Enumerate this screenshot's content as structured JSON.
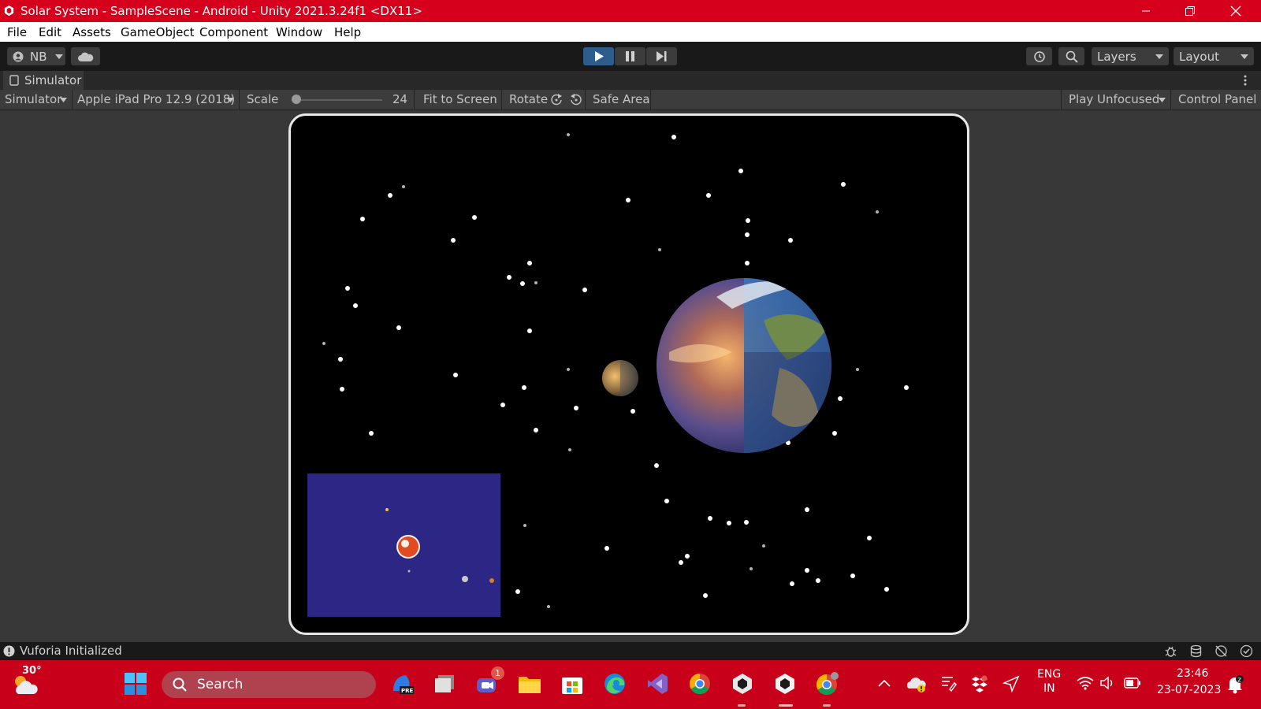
{
  "window": {
    "title": "Solar System - SampleScene - Android - Unity 2021.3.24f1 <DX11>"
  },
  "menu": [
    "File",
    "Edit",
    "Assets",
    "GameObject",
    "Component",
    "Window",
    "Help"
  ],
  "toolbar": {
    "account": "NB",
    "layers": "Layers",
    "layout": "Layout"
  },
  "simulator": {
    "tab": "Simulator",
    "mode": "Simulator",
    "device": "Apple iPad Pro 12.9 (2018)",
    "scale_label": "Scale",
    "scale_value": "24",
    "scale_fraction": 0.05,
    "fit": "Fit to Screen",
    "rotate": "Rotate",
    "safe_area": "Safe Area",
    "play_mode": "Play Unfocused",
    "control_panel": "Control Panel"
  },
  "status": {
    "message": "Vuforia Initialized"
  },
  "taskbar": {
    "weather": "30°",
    "search": "Search",
    "chat_badge": "1",
    "lang_top": "ENG",
    "lang_bottom": "IN",
    "time": "23:46",
    "date": "23-07-2023"
  },
  "colors": {
    "titlebar": "#d6001c",
    "taskbar": "#c8001a",
    "minimap": "#2c2684",
    "play_active": "#2e5d8c"
  }
}
